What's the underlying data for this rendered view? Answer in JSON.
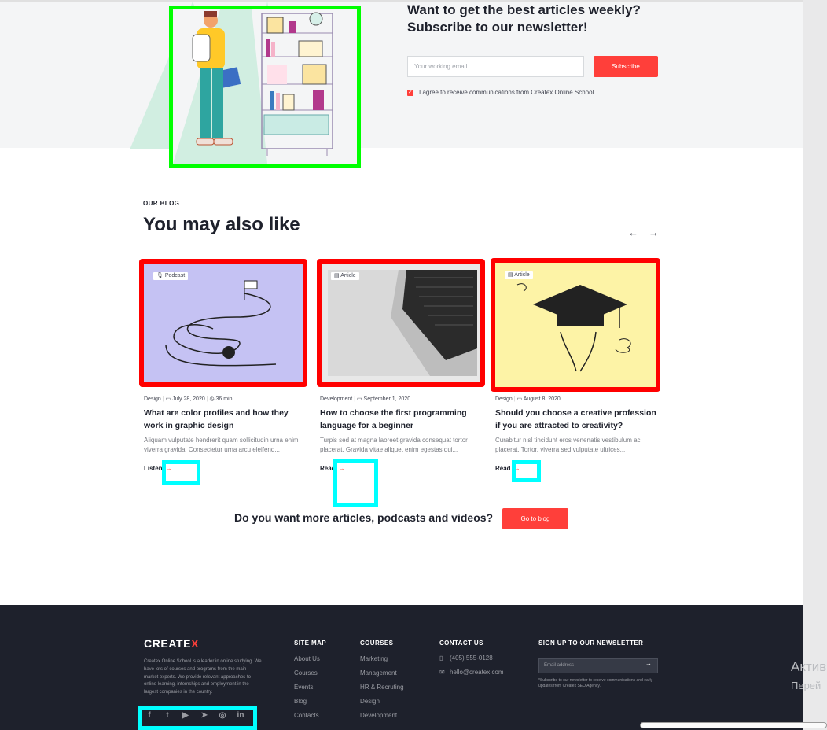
{
  "newsletter": {
    "title": "Want to get the best articles weekly? Subscribe to our newsletter!",
    "email_placeholder": "Your working email",
    "subscribe_label": "Subscribe",
    "agree_label": "I agree to receive communications from Createx Online School"
  },
  "blog": {
    "eyebrow": "OUR BLOG",
    "title": "You may also like",
    "prev_icon": "arrow-left-icon",
    "next_icon": "arrow-right-icon",
    "cards": [
      {
        "badge": "Podcast",
        "category": "Design",
        "date": "July 28, 2020",
        "duration": "36 min",
        "title": "What are color profiles and how they work in graphic design",
        "text": "Aliquam vulputate hendrerit quam sollicitudin urna enim viverra gravida. Consectetur urna arcu eleifend...",
        "cta": "Listen"
      },
      {
        "badge": "Article",
        "category": "Development",
        "date": "September 1, 2020",
        "title": "How to choose the first programming language for a beginner",
        "text": "Turpis sed at magna laoreet gravida consequat tortor placerat. Gravida vitae aliquet enim egestas dui...",
        "cta": "Read"
      },
      {
        "badge": "Article",
        "category": "Design",
        "date": "August 8, 2020",
        "title": "Should you choose a creative profession if you are attracted to creativity?",
        "text": "Curabitur nisl tincidunt eros venenatis vestibulum ac placerat. Tortor, viverra sed vulputate ultrices...",
        "cta": "Read"
      }
    ],
    "more_text": "Do you want more articles, podcasts and videos?",
    "go_to_blog": "Go to blog"
  },
  "footer": {
    "logo_main": "CREATE",
    "logo_x": "X",
    "about": "Createx Online School is a leader in online studying. We have lots of courses and programs from the main market experts. We provide relevant approaches to online learning, internships and employment in the largest companies in the country.",
    "site_map": {
      "heading": "SITE MAP",
      "links": [
        "About Us",
        "Courses",
        "Events",
        "Blog",
        "Contacts"
      ]
    },
    "courses": {
      "heading": "COURSES",
      "links": [
        "Marketing",
        "Management",
        "HR & Recruting",
        "Design",
        "Development"
      ]
    },
    "contact": {
      "heading": "CONTACT US",
      "phone": "(405) 555-0128",
      "email": "hello@createx.com"
    },
    "newsletter": {
      "heading": "SIGN UP TO OUR NEWSLETTER",
      "placeholder": "Email address",
      "note": "*Subscribe to our newsletter to receive communications and early updates from Createx SEO Agency."
    },
    "social": [
      "facebook-icon",
      "twitter-icon",
      "youtube-icon",
      "telegram-icon",
      "instagram-icon",
      "linkedin-icon"
    ]
  },
  "os_watermark": {
    "line1": "Актив",
    "line2": "Перей"
  },
  "colors": {
    "accent": "#ff3f3a",
    "dark": "#1e212c",
    "highlight_green": "#00ff00",
    "highlight_red": "#ff0000",
    "highlight_cyan": "#00ffff"
  }
}
